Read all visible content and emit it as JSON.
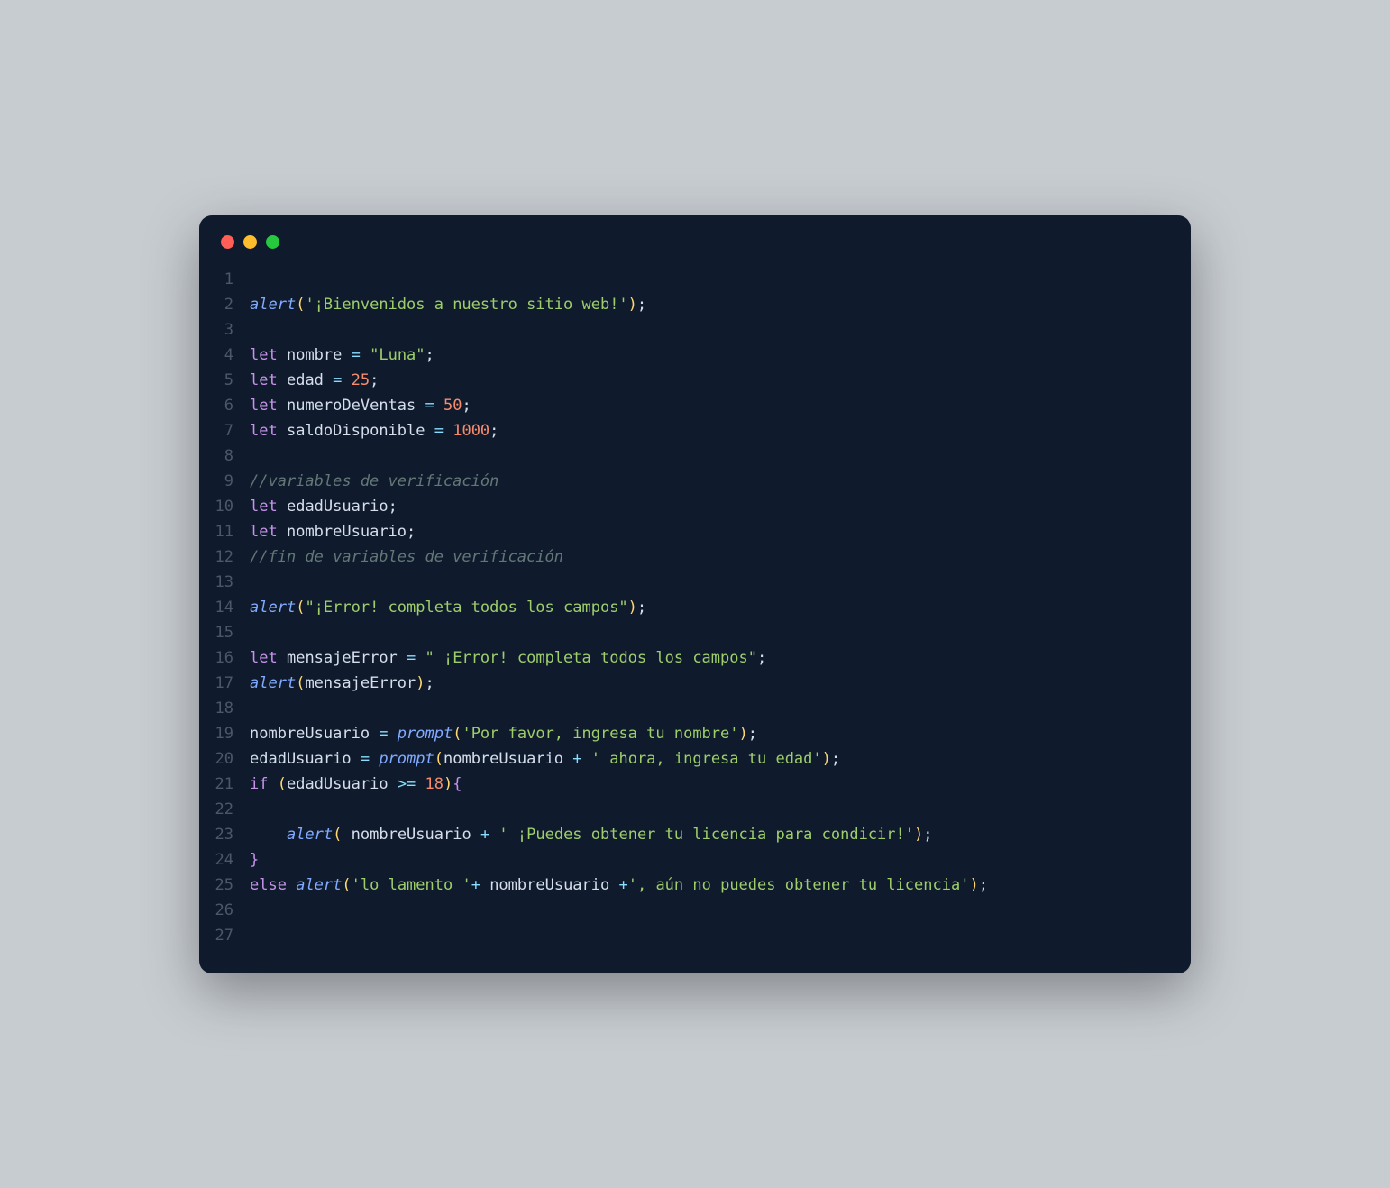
{
  "window": {
    "traffic": {
      "red": "#ff5f56",
      "yellow": "#ffbd2e",
      "green": "#27c93f"
    }
  },
  "lineCount": 27,
  "code": {
    "l1": "",
    "l2": {
      "fn": "alert",
      "str": "'¡Bienvenidos a nuestro sitio web!'"
    },
    "l3": "",
    "l4": {
      "kw": "let",
      "name": "nombre",
      "eq": " = ",
      "val": "\"Luna\"",
      "valType": "str"
    },
    "l5": {
      "kw": "let",
      "name": "edad",
      "eq": " = ",
      "val": "25",
      "valType": "num"
    },
    "l6": {
      "kw": "let",
      "name": "numeroDeVentas",
      "eq": " = ",
      "val": "50",
      "valType": "num"
    },
    "l7": {
      "kw": "let",
      "name": "saldoDisponible",
      "eq": " = ",
      "val": "1000",
      "valType": "num"
    },
    "l8": "",
    "l9": {
      "cmt": "//variables de verificación"
    },
    "l10": {
      "kw": "let",
      "name": "edadUsuario"
    },
    "l11": {
      "kw": "let",
      "name": "nombreUsuario"
    },
    "l12": {
      "cmt": "//fin de variables de verificación"
    },
    "l13": "",
    "l14": {
      "fn": "alert",
      "str": "\"¡Error! completa todos los campos\""
    },
    "l15": "",
    "l16": {
      "kw": "let",
      "name": "mensajeError",
      "eq": " = ",
      "val": "\" ¡Error! completa todos los campos\"",
      "valType": "str"
    },
    "l17": {
      "fn": "alert",
      "arg": "mensajeError"
    },
    "l18": "",
    "l19": {
      "lhs": "nombreUsuario",
      "eq": " = ",
      "fn": "prompt",
      "str": "'Por favor, ingresa tu nombre'"
    },
    "l20": {
      "lhs": "edadUsuario",
      "eq": " = ",
      "fn": "prompt",
      "arg1": "nombreUsuario",
      "plus": " + ",
      "str": "' ahora, ingresa tu edad'"
    },
    "l21": {
      "kw": "if",
      "cond_var": "edadUsuario",
      "cond_op": " >= ",
      "cond_num": "18"
    },
    "l22": "",
    "l23": {
      "indent": "    ",
      "fn": "alert",
      "sp": " ",
      "arg1": "nombreUsuario",
      "plus": " + ",
      "str": "' ¡Puedes obtener tu licencia para condicir!'"
    },
    "l24": {
      "close": "}"
    },
    "l25": {
      "kw": "else",
      "fn": "alert",
      "str1": "'lo lamento '",
      "plus1": "+ ",
      "arg": "nombreUsuario",
      "plus2": " +",
      "str2": "', aún no puedes obtener tu licencia'"
    },
    "l26": "",
    "l27": ""
  }
}
